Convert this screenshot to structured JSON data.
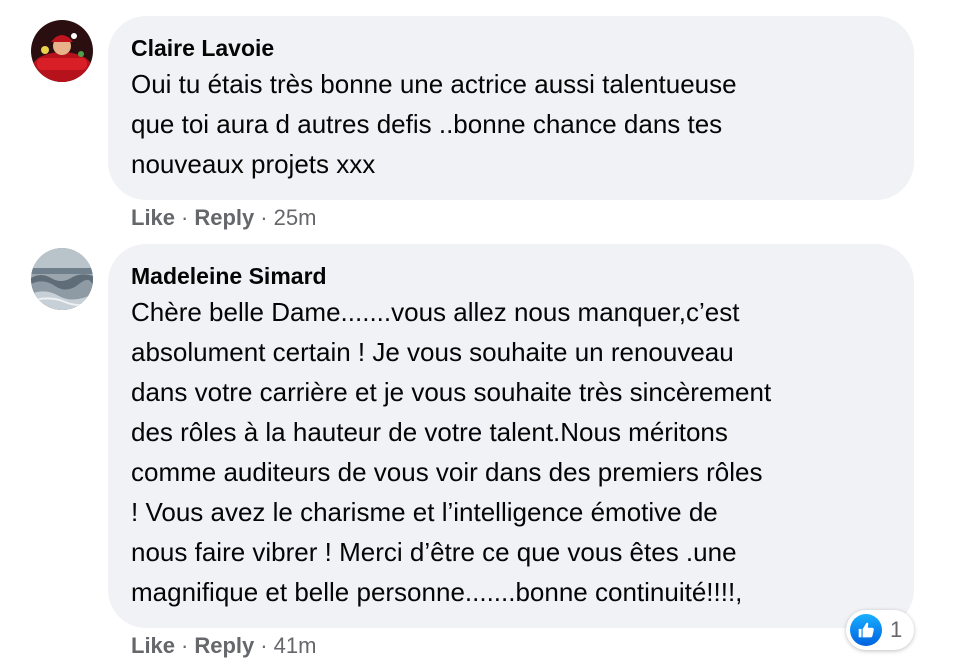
{
  "comments": [
    {
      "author": "Claire Lavoie",
      "text": "Oui tu étais très bonne une actrice aussi talentueuse\nque toi aura d autres defis ..bonne chance dans tes\nnouveaux projets xxx",
      "like_label": "Like",
      "reply_label": "Reply",
      "separator": "·",
      "time": "25m",
      "avatar_icon": "avatar-red-photo"
    },
    {
      "author": "Madeleine Simard",
      "text": "Chère belle Dame.......vous allez nous manquer,c’est\nabsolument certain ! Je vous souhaite un renouveau\ndans votre carrière et je vous souhaite très sincèrement\ndes rôles à la hauteur de votre talent.Nous méritons\ncomme auditeurs de vous voir dans des premiers rôles\n! Vous avez le charisme et l’intelligence émotive de\nnous faire vibrer ! Merci d’être ce que vous êtes .une\nmagnifique et belle personne.......bonne continuité!!!!,",
      "like_label": "Like",
      "reply_label": "Reply",
      "separator": "·",
      "time": "41m",
      "avatar_icon": "avatar-ocean-photo",
      "reactions": {
        "icon": "thumbs-up-icon",
        "count": "1"
      }
    }
  ],
  "colors": {
    "bubble_bg": "#f0f2f5",
    "meta_text": "#65676b",
    "like_blue": "#0866ff"
  }
}
